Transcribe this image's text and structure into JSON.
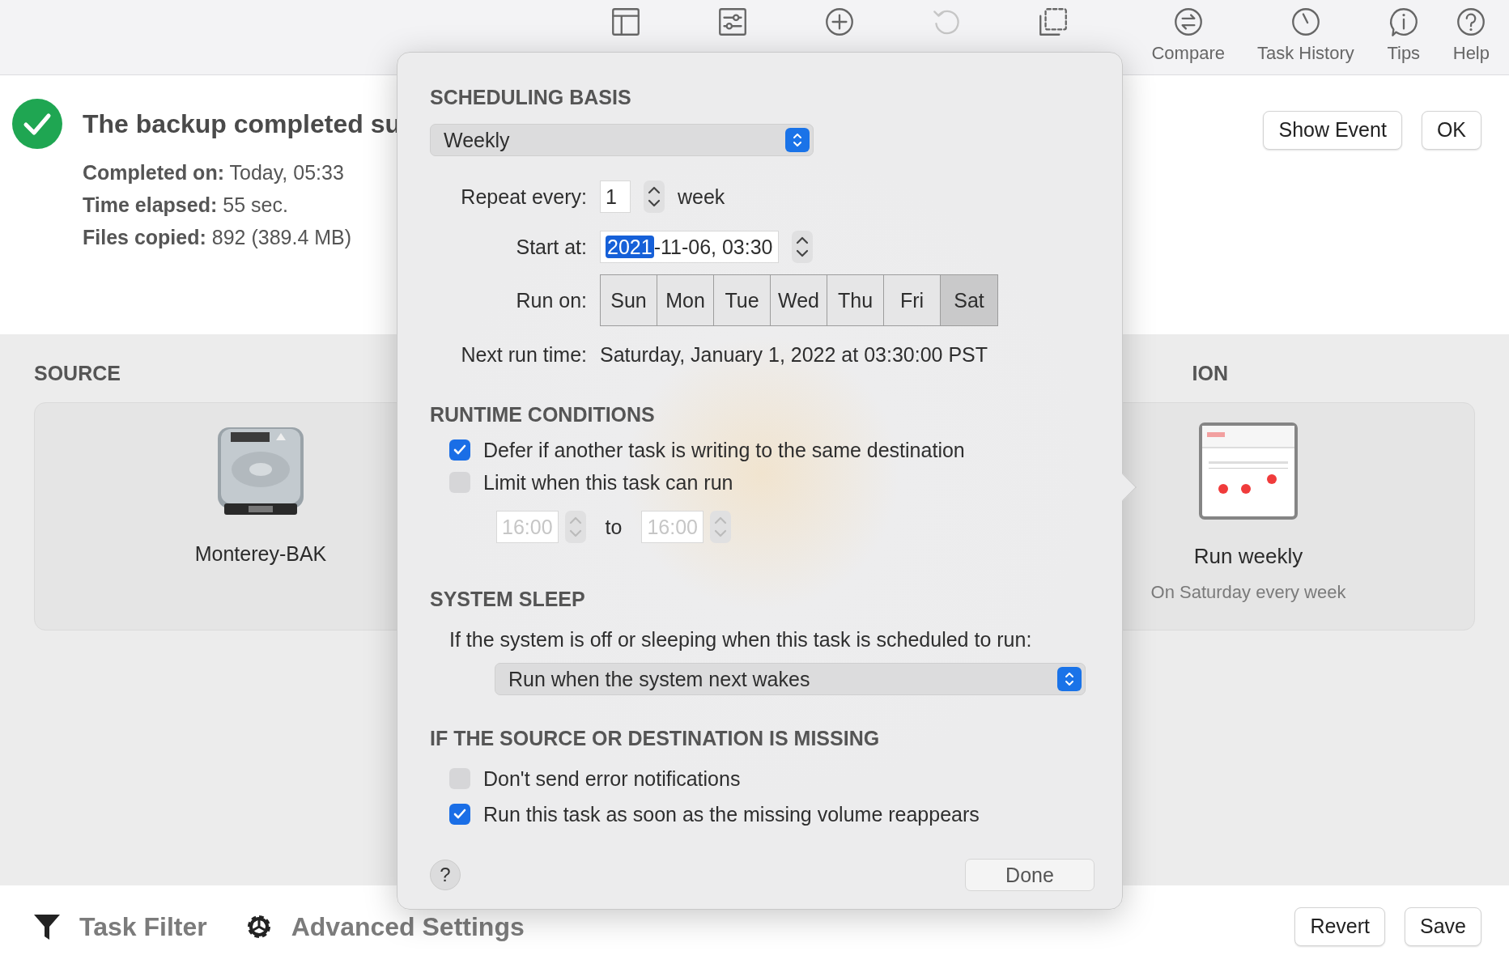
{
  "toolbar": {
    "items": [
      {
        "kind": "layout"
      },
      {
        "kind": "sliders"
      },
      {
        "kind": "add"
      },
      {
        "kind": "undo",
        "disabled": true
      },
      {
        "kind": "select"
      },
      {
        "kind": "compare",
        "label": "Compare"
      },
      {
        "kind": "history",
        "label": "Task History"
      },
      {
        "kind": "tips",
        "label": "Tips"
      },
      {
        "kind": "help",
        "label": "Help"
      }
    ]
  },
  "summary": {
    "title": "The backup completed su",
    "lines": [
      {
        "label": "Completed on:",
        "value": "Today, 05:33"
      },
      {
        "label": "Time elapsed:",
        "value": "55 sec."
      },
      {
        "label": "Files copied:",
        "value": "892 (389.4 MB)"
      }
    ],
    "buttons": [
      "Show Event",
      "OK"
    ]
  },
  "source": {
    "heading": "SOURCE",
    "name": "Monterey-BAK"
  },
  "destination": {
    "heading": "ION",
    "title": "Run weekly",
    "subtitle": "On Saturday every week"
  },
  "footer": {
    "tools": [
      {
        "kind": "filter",
        "label": "Task Filter"
      },
      {
        "kind": "gear",
        "label": "Advanced Settings"
      }
    ],
    "buttons": [
      "Revert",
      "Save"
    ]
  },
  "popover": {
    "scheduling": {
      "heading": "SCHEDULING BASIS",
      "basis": "Weekly",
      "repeat_label": "Repeat every:",
      "repeat_value": "1",
      "repeat_unit": "week",
      "start_label": "Start at:",
      "start_selected": "2021",
      "start_rest": "-11-06, 03:30",
      "run_on_label": "Run on:",
      "days": [
        {
          "label": "Sun",
          "selected": false
        },
        {
          "label": "Mon",
          "selected": false
        },
        {
          "label": "Tue",
          "selected": false
        },
        {
          "label": "Wed",
          "selected": false
        },
        {
          "label": "Thu",
          "selected": false
        },
        {
          "label": "Fri",
          "selected": false
        },
        {
          "label": "Sat",
          "selected": true
        }
      ],
      "next_label": "Next run time:",
      "next_value": "Saturday, January 1, 2022 at 03:30:00 PST"
    },
    "runtime": {
      "heading": "RUNTIME CONDITIONS",
      "options": [
        {
          "label": "Defer if another task is writing to the same destination",
          "checked": true
        },
        {
          "label": "Limit when this task can run",
          "checked": false
        }
      ],
      "time_from": "16:00",
      "time_sep": "to",
      "time_to": "16:00",
      "times_disabled": true
    },
    "sleep": {
      "heading": "SYSTEM SLEEP",
      "prompt": "If the system is off or sleeping when this task is scheduled to run:",
      "choice": "Run when the system next wakes"
    },
    "missing": {
      "heading": "IF THE SOURCE OR DESTINATION IS MISSING",
      "options": [
        {
          "label": "Don't send error notifications",
          "checked": false
        },
        {
          "label": "Run this task as soon as the missing volume reappears",
          "checked": true
        }
      ]
    },
    "help": "?",
    "done": "Done"
  }
}
